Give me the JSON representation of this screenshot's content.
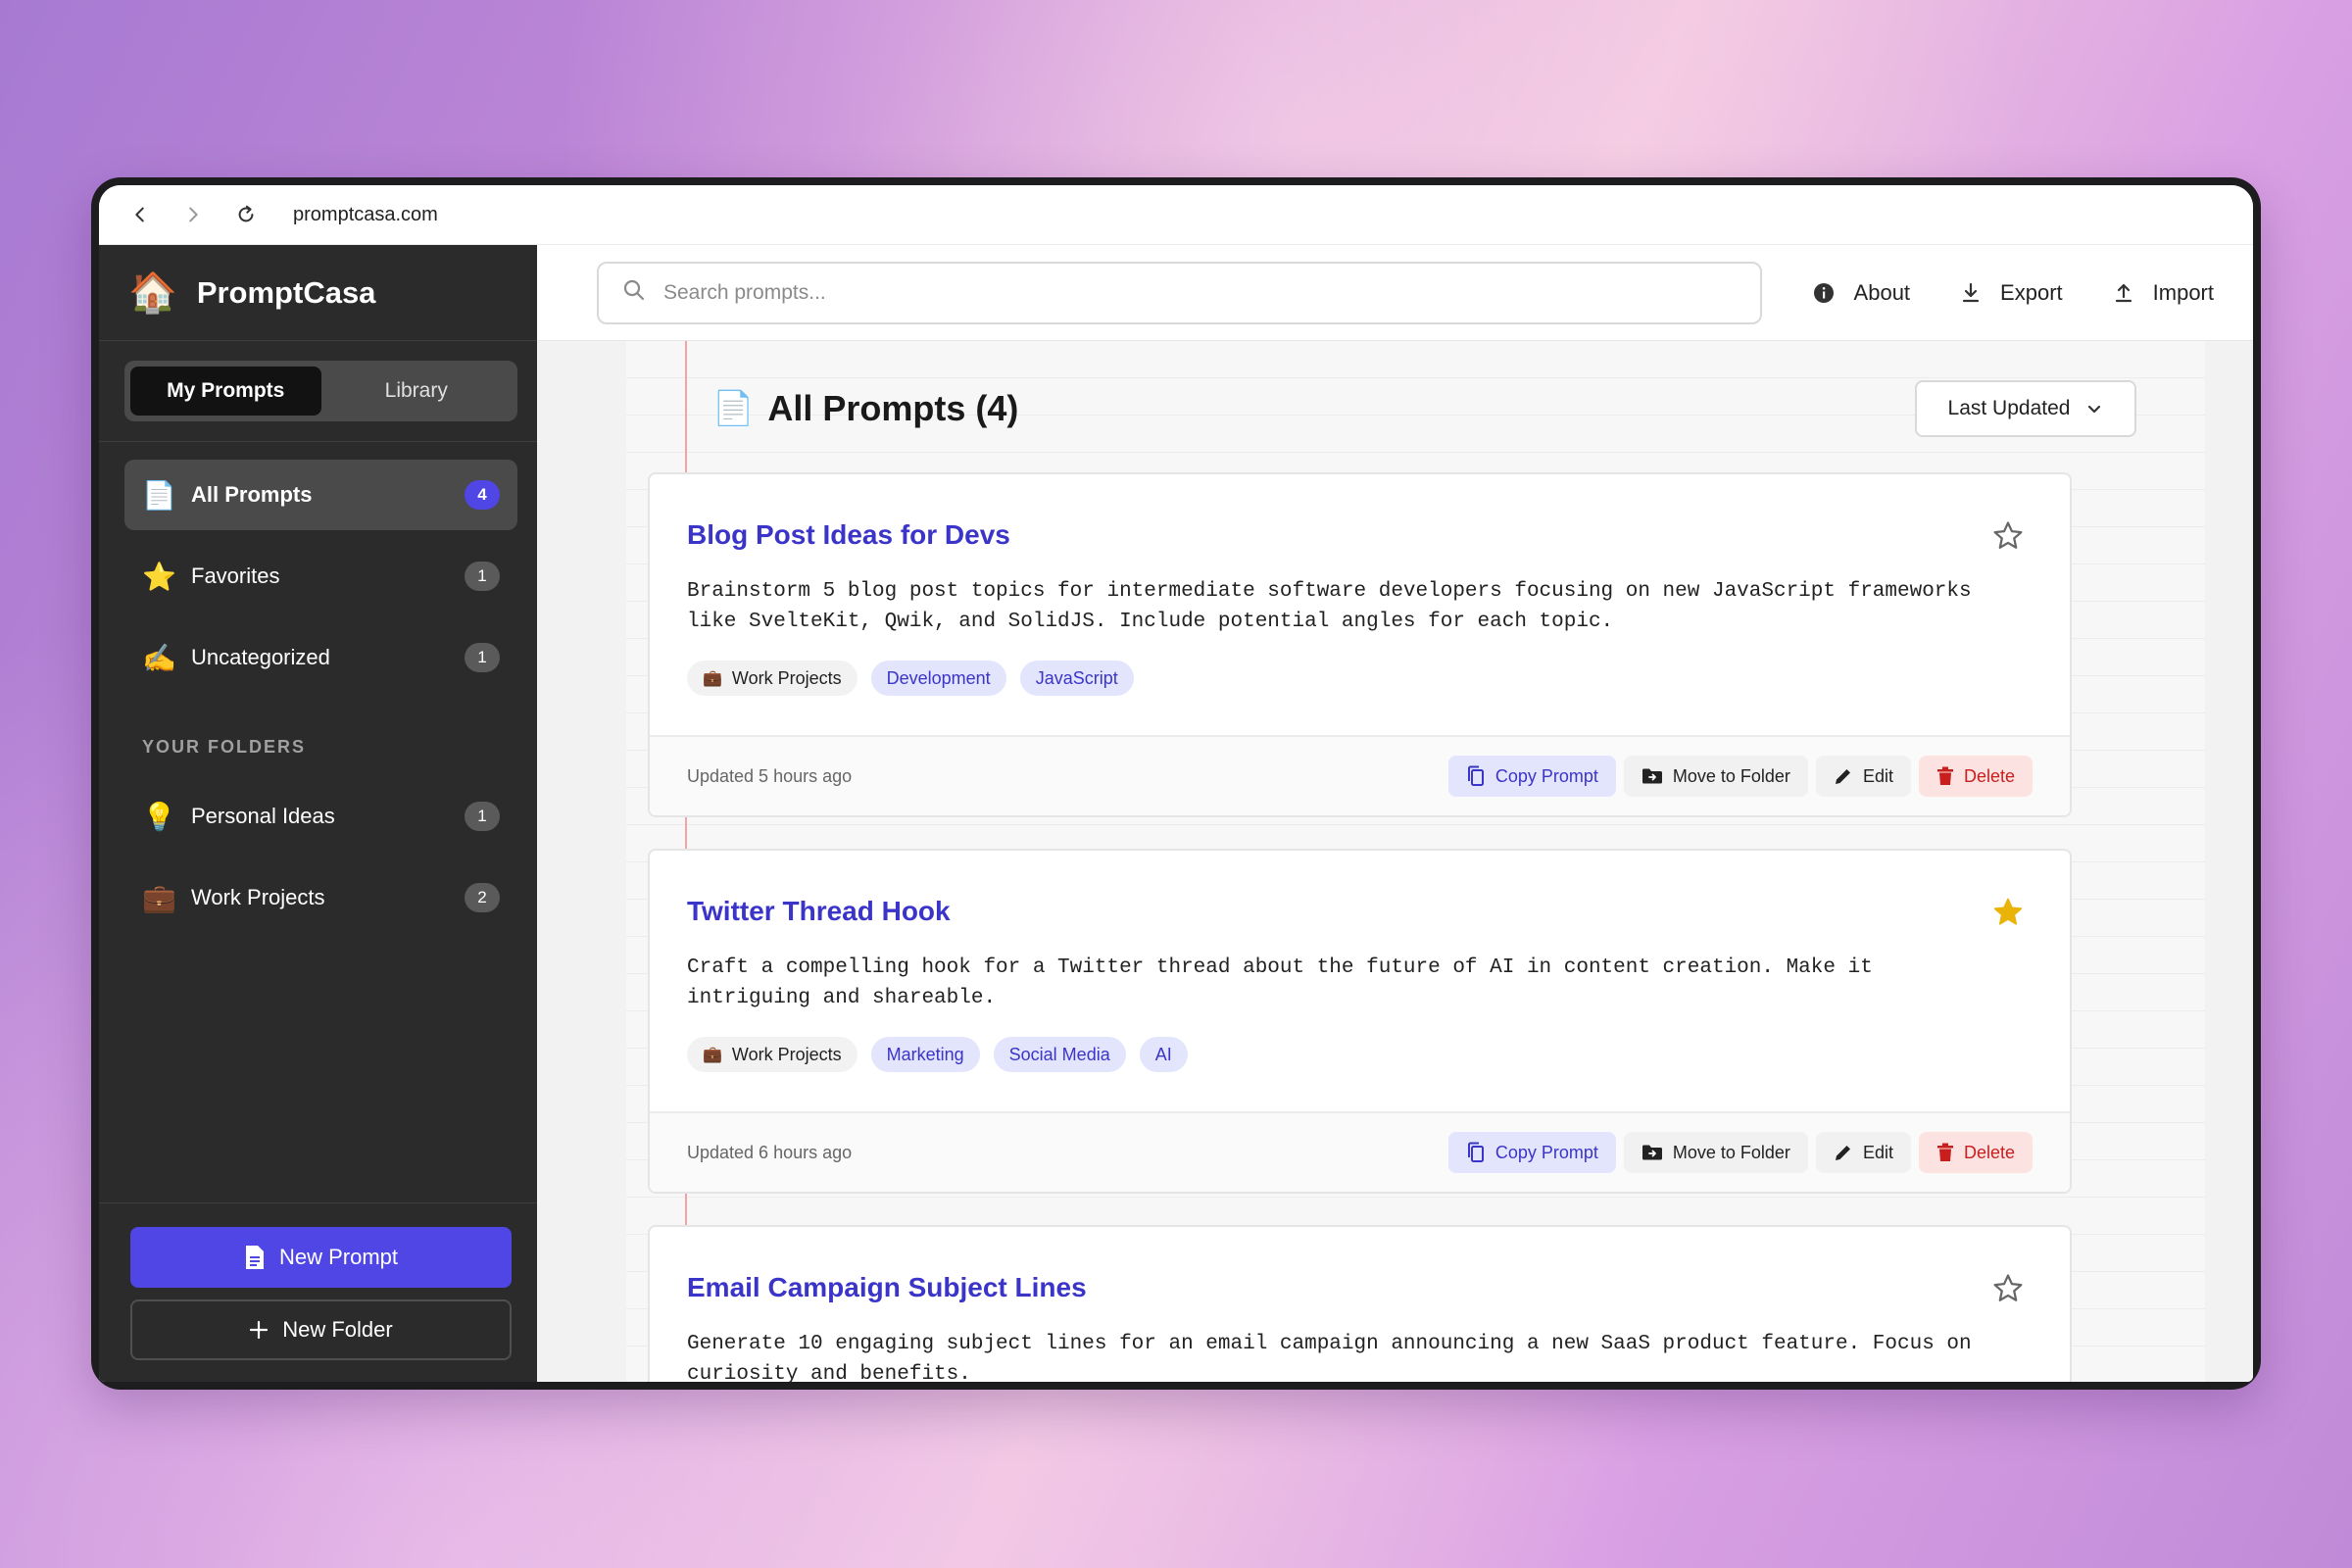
{
  "browser": {
    "url": "promptcasa.com"
  },
  "brand": {
    "emoji": "🏠",
    "name": "PromptCasa"
  },
  "toggle": {
    "my_prompts": "My Prompts",
    "library": "Library"
  },
  "nav": {
    "all": {
      "emoji": "📄",
      "label": "All Prompts",
      "count": "4"
    },
    "favorites": {
      "emoji": "⭐",
      "label": "Favorites",
      "count": "1"
    },
    "uncategorized": {
      "emoji": "✍️",
      "label": "Uncategorized",
      "count": "1"
    }
  },
  "folders_title": "YOUR FOLDERS",
  "folders": {
    "personal": {
      "emoji": "💡",
      "label": "Personal Ideas",
      "count": "1"
    },
    "work": {
      "emoji": "💼",
      "label": "Work Projects",
      "count": "2"
    }
  },
  "sidebar_buttons": {
    "new_prompt": "New Prompt",
    "new_folder": "New Folder"
  },
  "search": {
    "placeholder": "Search prompts..."
  },
  "top_actions": {
    "about": "About",
    "export": "Export",
    "import": "Import"
  },
  "list": {
    "icon": "📄",
    "title": "All Prompts (4)",
    "sort_label": "Last Updated"
  },
  "card_actions": {
    "copy": "Copy Prompt",
    "move": "Move to Folder",
    "edit": "Edit",
    "delete": "Delete"
  },
  "prompts": [
    {
      "title": "Blog Post Ideas for Devs",
      "favorite": false,
      "description": "Brainstorm 5 blog post topics for intermediate software developers focusing on new JavaScript frameworks\nlike SvelteKit, Qwik, and SolidJS. Include potential angles for each topic.",
      "folder": {
        "emoji": "💼",
        "name": "Work Projects"
      },
      "tags": [
        "Development",
        "JavaScript"
      ],
      "updated": "Updated 5 hours ago"
    },
    {
      "title": "Twitter Thread Hook",
      "favorite": true,
      "description": "Craft a compelling hook for a Twitter thread about the future of AI in content creation. Make it\nintriguing and shareable.",
      "folder": {
        "emoji": "💼",
        "name": "Work Projects"
      },
      "tags": [
        "Marketing",
        "Social Media",
        "AI"
      ],
      "updated": "Updated 6 hours ago"
    },
    {
      "title": "Email Campaign Subject Lines",
      "favorite": false,
      "description": "Generate 10 engaging subject lines for an email campaign announcing a new SaaS product feature. Focus on\ncuriosity and benefits.",
      "folder": null,
      "tags": [],
      "updated": ""
    }
  ],
  "colors": {
    "accent": "#4f46e5",
    "link": "#3b34c9",
    "star": "#eab308",
    "danger": "#c81e1e",
    "sidebar": "#2b2b2b"
  }
}
